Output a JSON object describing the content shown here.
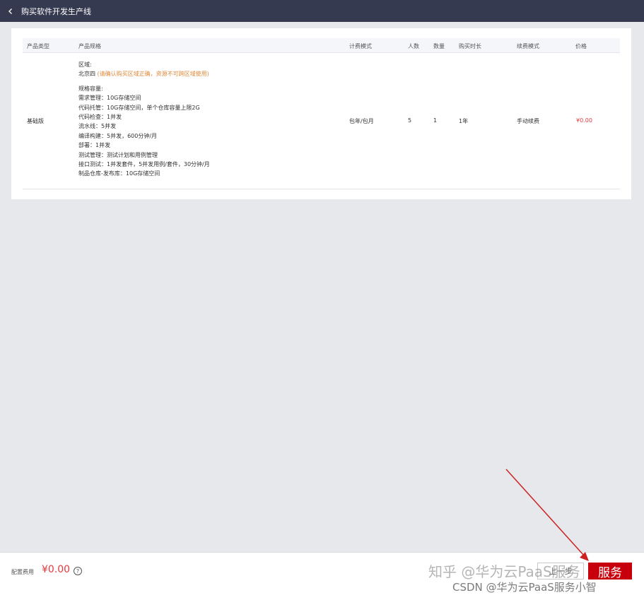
{
  "header": {
    "title": "购买软件开发生产线"
  },
  "table": {
    "headers": {
      "type": "产品类型",
      "spec": "产品规格",
      "billing": "计费模式",
      "users": "人数",
      "qty": "数量",
      "duration": "购买时长",
      "renew": "续费模式",
      "price": "价格"
    },
    "row": {
      "type": "基础版",
      "region_label": "区域:",
      "region_value": "北京四",
      "region_note": "(请确认购买区域正确，资源不可跨区域使用)",
      "spec_label": "规格容量:",
      "spec_lines": [
        "需求管理：10G存储空间",
        "代码托管：10G存储空间，单个仓库容量上限2G",
        "代码检查：1并发",
        "流水线：5并发",
        "编译构建：5并发，600分钟/月",
        "部署：1并发",
        "测试管理：测试计划和用例管理",
        "接口测试：1并发套件，5并发用例/套件，30分钟/月",
        "制品仓库-发布库：10G存储空间"
      ],
      "billing": "包年/包月",
      "users": "5",
      "qty": "1",
      "duration": "1年",
      "renew": "手动续费",
      "price": "¥0.00"
    }
  },
  "footer": {
    "fee_label": "配置费用",
    "fee_value": "¥0.00",
    "help_icon": "?",
    "outline_button": "上一步",
    "buy_button": "服务"
  },
  "watermarks": {
    "line1": "知乎 @华为云PaaS服务",
    "line2": "CSDN @华为云PaaS服务小智"
  },
  "colors": {
    "topbar": "#363a51",
    "price": "#e4393c",
    "buy_button": "#c7000b",
    "arrow": "#cc2222"
  }
}
